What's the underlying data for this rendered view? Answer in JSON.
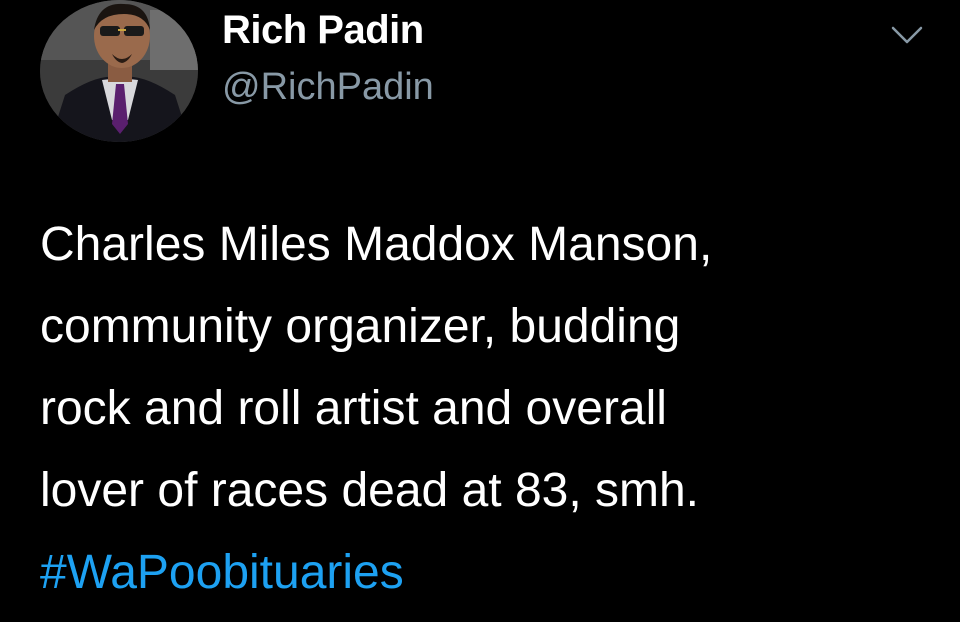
{
  "tweet": {
    "author": {
      "display_name": "Rich Padin",
      "handle": "@RichPadin",
      "avatar_icon": "profile-photo"
    },
    "menu_icon": "chevron-down-icon",
    "text_lines": [
      "Charles Miles Maddox Manson,",
      "community organizer, budding",
      "rock and roll artist and overall",
      "lover of races dead at 83, smh."
    ],
    "hashtag": "#WaPoobituaries"
  },
  "colors": {
    "background": "#000000",
    "primary_text": "#ffffff",
    "secondary_text": "#8899a6",
    "link": "#1da1f2"
  }
}
